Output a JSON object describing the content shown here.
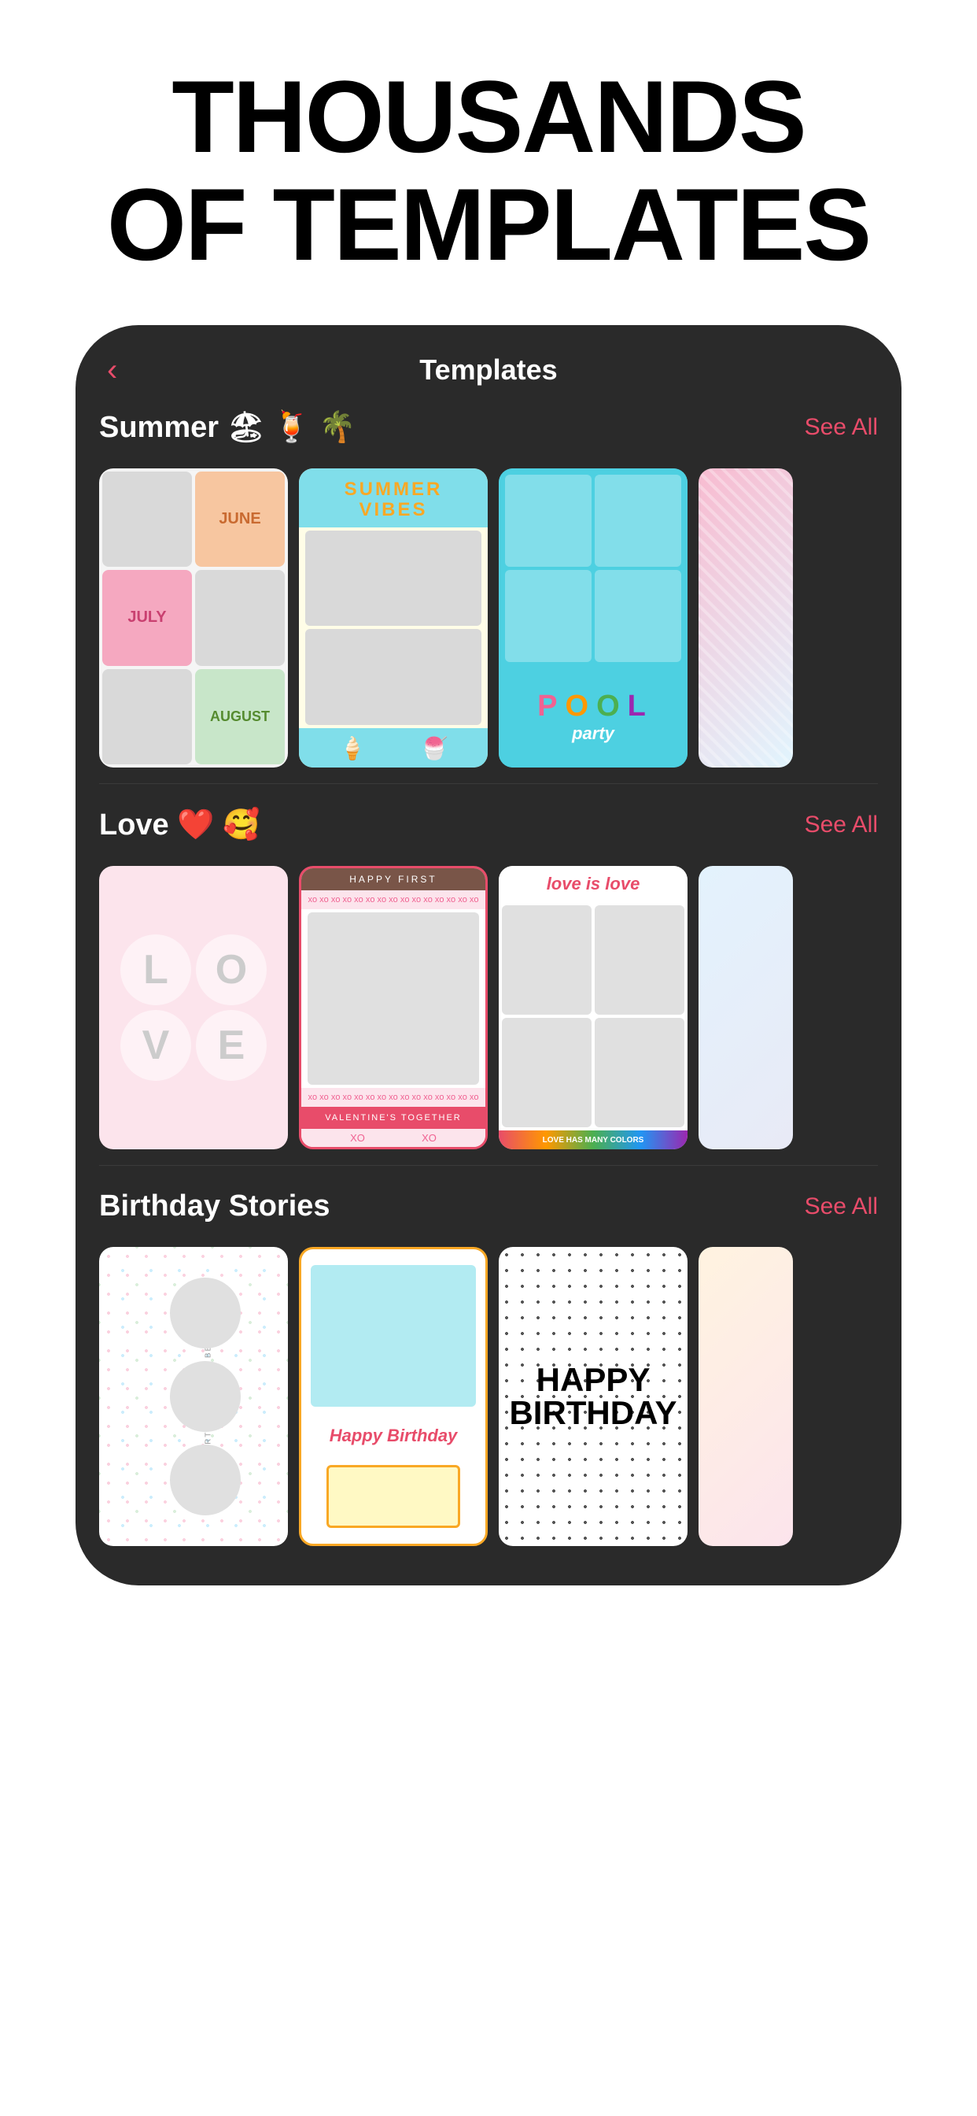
{
  "hero": {
    "title": "THOUSANDS\nOF TEMPLATES"
  },
  "app": {
    "header": {
      "back_label": "‹",
      "title": "Templates"
    },
    "sections": [
      {
        "id": "summer",
        "title": "Summer 🏖 🍹 🌴",
        "see_all_label": "See All",
        "cards": [
          {
            "id": "summer-months",
            "label": "JUNE / JULY / AUGUST grid"
          },
          {
            "id": "summer-vibes",
            "label": "SUMMER VIBES"
          },
          {
            "id": "pool-party",
            "label": "POOL party"
          },
          {
            "id": "summer-partial",
            "label": "partial card"
          }
        ]
      },
      {
        "id": "love",
        "title": "Love ❤️ 🥰",
        "see_all_label": "See All",
        "cards": [
          {
            "id": "love-letters",
            "label": "LOVE letters"
          },
          {
            "id": "valentines",
            "label": "VALENTINE'S TOGETHER"
          },
          {
            "id": "love-is-love",
            "label": "love is love"
          },
          {
            "id": "love-partial",
            "label": "partial card"
          }
        ]
      },
      {
        "id": "birthday",
        "title": "Birthday Stories",
        "see_all_label": "See All",
        "cards": [
          {
            "id": "bday-circles",
            "label": "Happy birthday circles"
          },
          {
            "id": "bday-frame",
            "label": "Happy Birthday frame"
          },
          {
            "id": "bday-dots",
            "label": "HAPPY BIRTHDAY dots"
          },
          {
            "id": "bday-partial",
            "label": "partial card"
          }
        ]
      }
    ]
  }
}
